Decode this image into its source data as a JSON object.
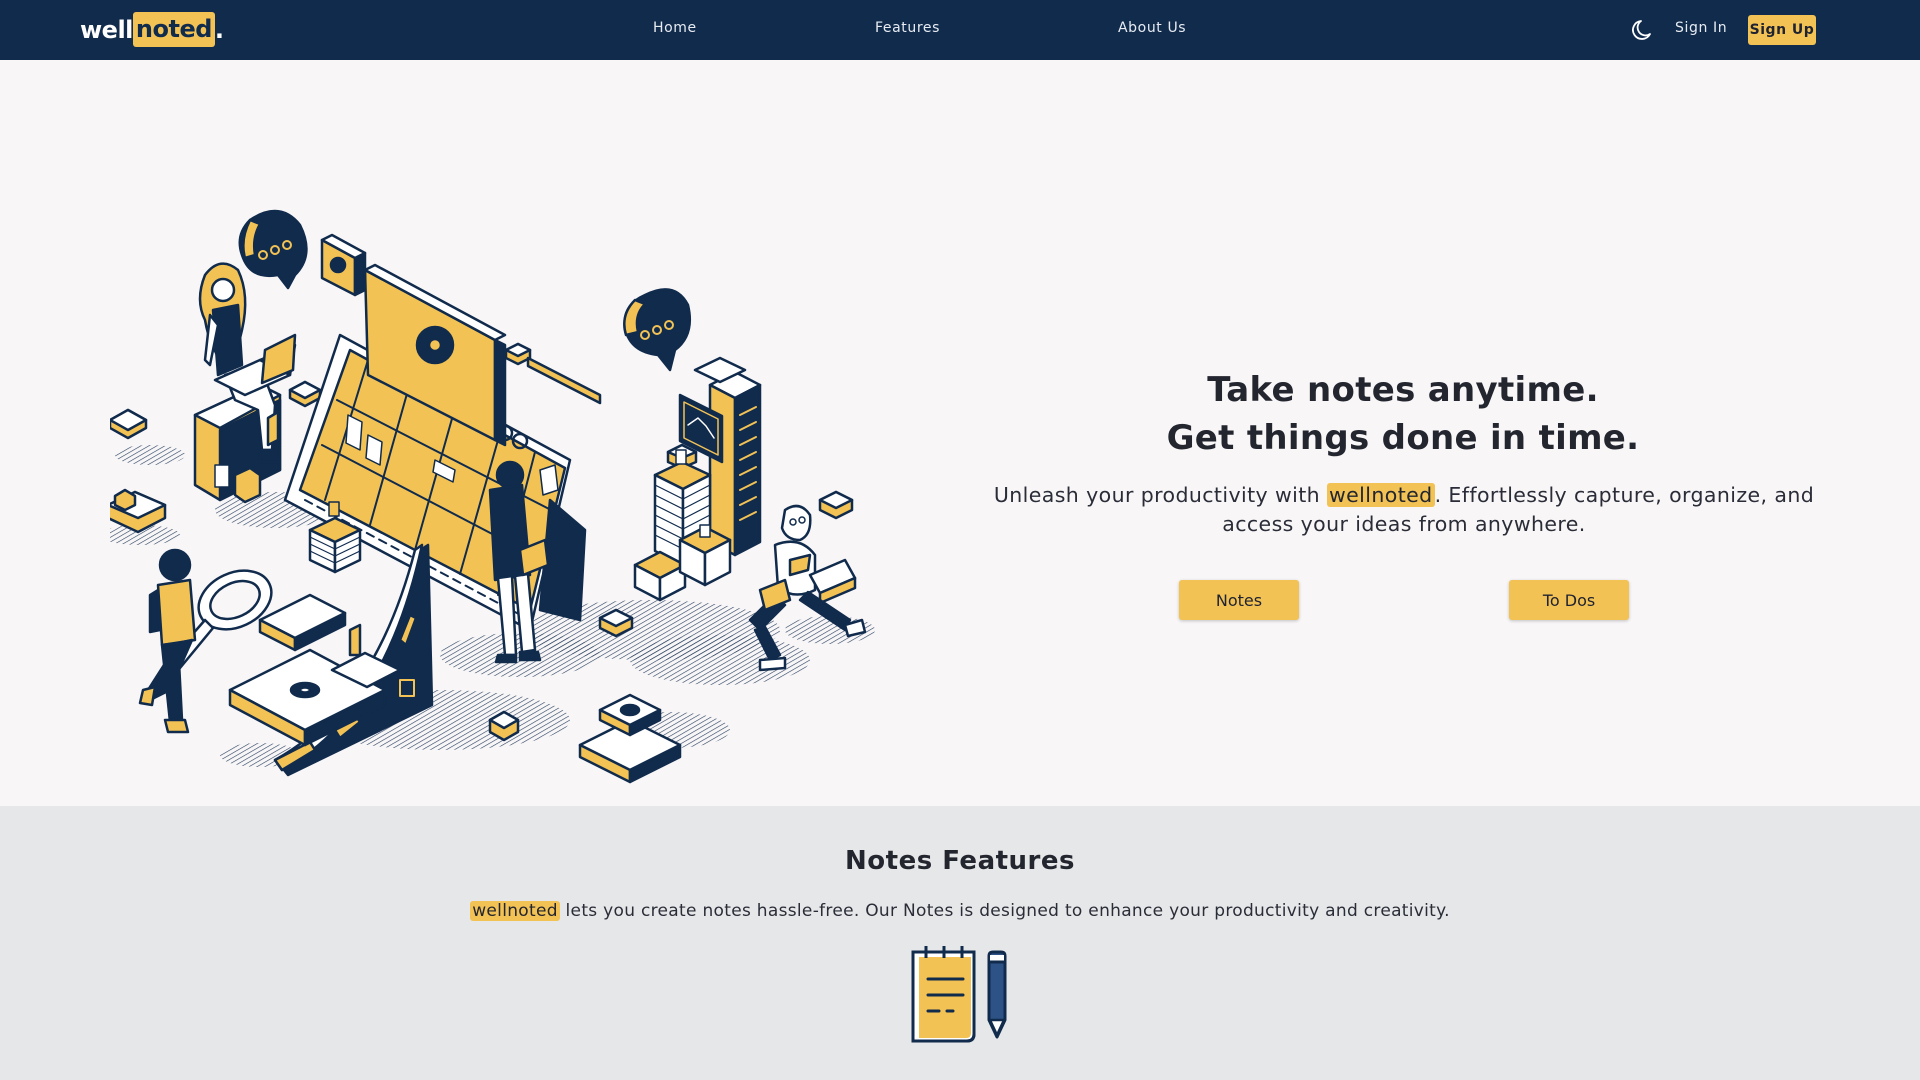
{
  "navbar": {
    "logo": {
      "part1": "well",
      "part2": "noted",
      "part3": "."
    },
    "links": [
      {
        "label": "Home"
      },
      {
        "label": "Features"
      },
      {
        "label": "About Us"
      }
    ],
    "theme_toggle_icon": "moon-icon",
    "sign_in_label": "Sign In",
    "sign_up_label": "Sign Up"
  },
  "hero": {
    "illustration": "isometric-productivity-illustration",
    "title_line1": "Take notes anytime.",
    "title_line2": "Get things done in time.",
    "description_before": "Unleash your productivity with ",
    "description_brand": "wellnoted",
    "description_after": ". Effortlessly capture, organize, and access your ideas from anywhere.",
    "buttons": [
      {
        "label": "Notes"
      },
      {
        "label": "To Dos"
      }
    ]
  },
  "features": {
    "title": "Notes Features",
    "description_brand": "wellnoted",
    "description_after": " lets you create notes hassle-free. Our Notes is designed to enhance your productivity and creativity.",
    "icon": "notepad-pencil-icon"
  },
  "colors": {
    "navy": "#112b4d",
    "accent_yellow": "#f2c254",
    "hero_bg": "#f8f6f7",
    "features_bg": "#e6e7e8",
    "text_dark": "#23252f"
  }
}
